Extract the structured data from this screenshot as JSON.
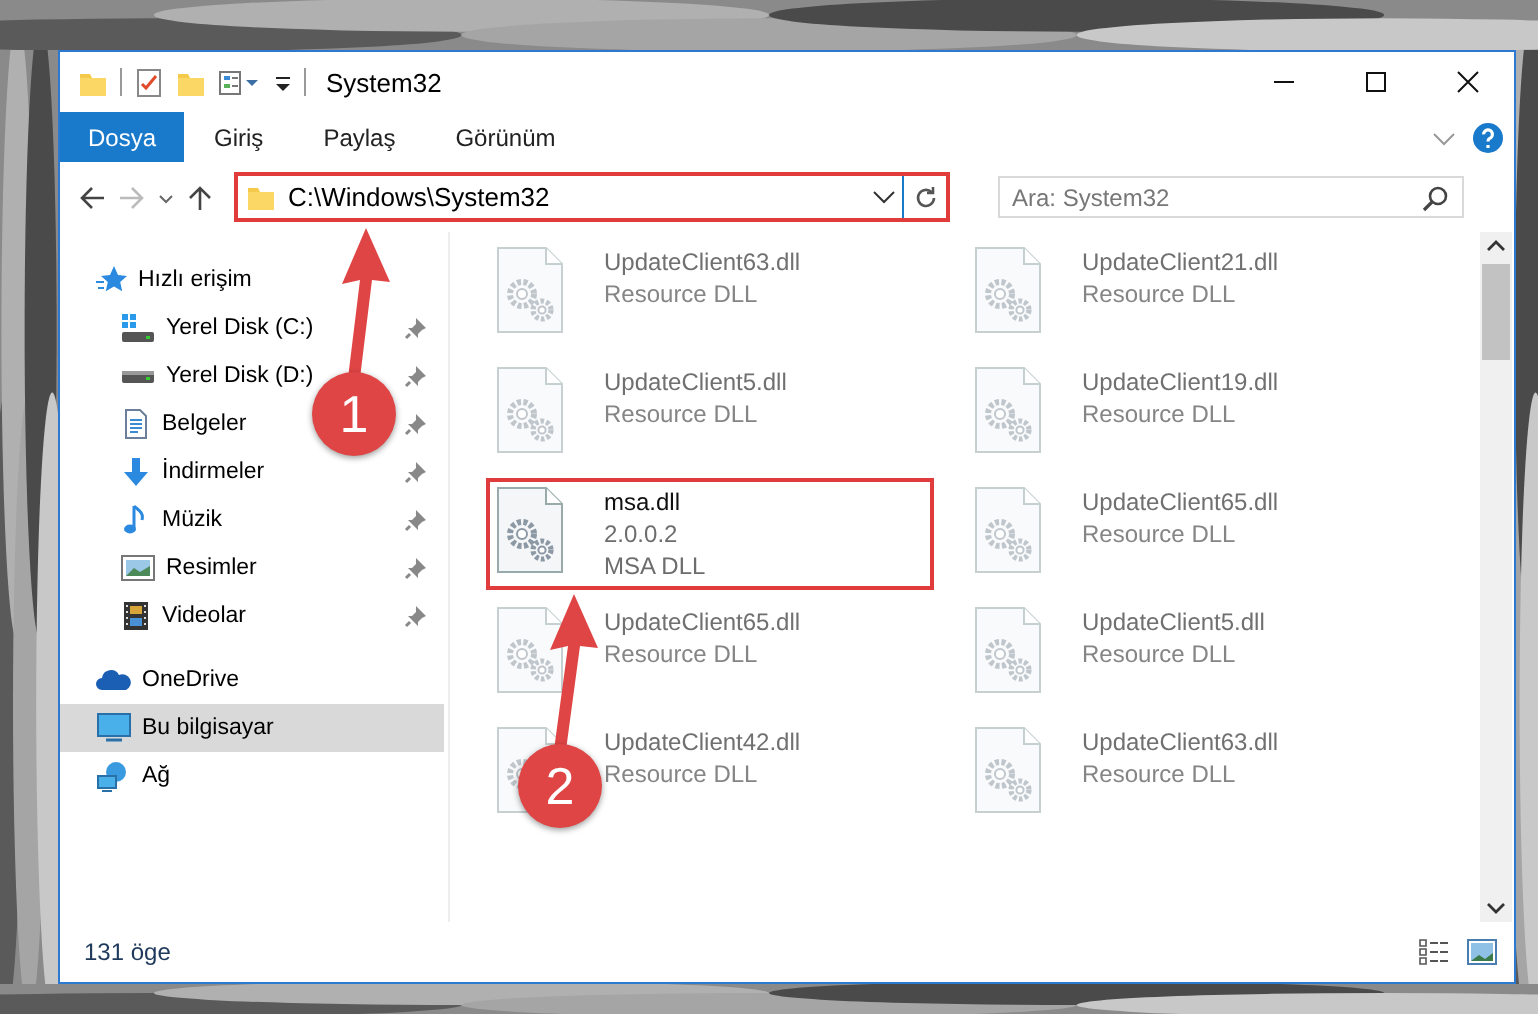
{
  "window": {
    "title": "System32"
  },
  "ribbon_tabs": [
    {
      "label": "Dosya",
      "kind": "file",
      "selected": false
    },
    {
      "label": "Giriş",
      "kind": "tab",
      "selected": false
    },
    {
      "label": "Paylaş",
      "kind": "tab",
      "selected": false
    },
    {
      "label": "Görünüm",
      "kind": "tab",
      "selected": false
    }
  ],
  "address": {
    "value": "C:\\Windows\\System32",
    "highlighted": true
  },
  "search": {
    "placeholder": "Ara: System32"
  },
  "sidebar": {
    "items": [
      {
        "label": "Hızlı erişim",
        "kind": "star",
        "selected": false,
        "children": [
          {
            "label": "Yerel Disk (C:)",
            "kind": "system-drive",
            "pinned": true,
            "selected": false
          },
          {
            "label": "Yerel Disk (D:)",
            "kind": "drive",
            "pinned": true,
            "selected": false
          },
          {
            "label": "Belgeler",
            "kind": "documents",
            "pinned": true,
            "selected": false
          },
          {
            "label": "İndirmeler",
            "kind": "downloads",
            "pinned": true,
            "selected": false
          },
          {
            "label": "Müzik",
            "kind": "music",
            "pinned": true,
            "selected": false
          },
          {
            "label": "Resimler",
            "kind": "pictures",
            "pinned": true,
            "selected": false
          },
          {
            "label": "Videolar",
            "kind": "videos",
            "pinned": true,
            "selected": false
          }
        ]
      },
      {
        "label": "OneDrive",
        "kind": "cloud",
        "selected": false
      },
      {
        "label": "Bu bilgisayar",
        "kind": "computer",
        "selected": true
      },
      {
        "label": "Ağ",
        "kind": "network",
        "selected": false
      }
    ]
  },
  "files": [
    {
      "name": "UpdateClient63.dll",
      "details": [
        "Resource DLL"
      ],
      "blurred": true,
      "highlighted": false
    },
    {
      "name": "UpdateClient21.dll",
      "details": [
        "Resource DLL"
      ],
      "blurred": true,
      "highlighted": false
    },
    {
      "name": "UpdateClient5.dll",
      "details": [
        "Resource DLL"
      ],
      "blurred": true,
      "highlighted": false
    },
    {
      "name": "UpdateClient19.dll",
      "details": [
        "Resource DLL"
      ],
      "blurred": true,
      "highlighted": false
    },
    {
      "name": "msa.dll",
      "details": [
        "2.0.0.2",
        "MSA DLL"
      ],
      "blurred": false,
      "highlighted": true
    },
    {
      "name": "UpdateClient65.dll",
      "details": [
        "Resource DLL"
      ],
      "blurred": true,
      "highlighted": false
    },
    {
      "name": "UpdateClient65.dll",
      "details": [
        "Resource DLL"
      ],
      "blurred": true,
      "highlighted": false
    },
    {
      "name": "UpdateClient5.dll",
      "details": [
        "Resource DLL"
      ],
      "blurred": true,
      "highlighted": false
    },
    {
      "name": "UpdateClient42.dll",
      "details": [
        "Resource DLL"
      ],
      "blurred": true,
      "highlighted": false
    },
    {
      "name": "UpdateClient63.dll",
      "details": [
        "Resource DLL"
      ],
      "blurred": true,
      "highlighted": false
    }
  ],
  "status_bar": {
    "item_count": "131 öge"
  },
  "annotations": [
    {
      "number": "1"
    },
    {
      "number": "2"
    }
  ]
}
